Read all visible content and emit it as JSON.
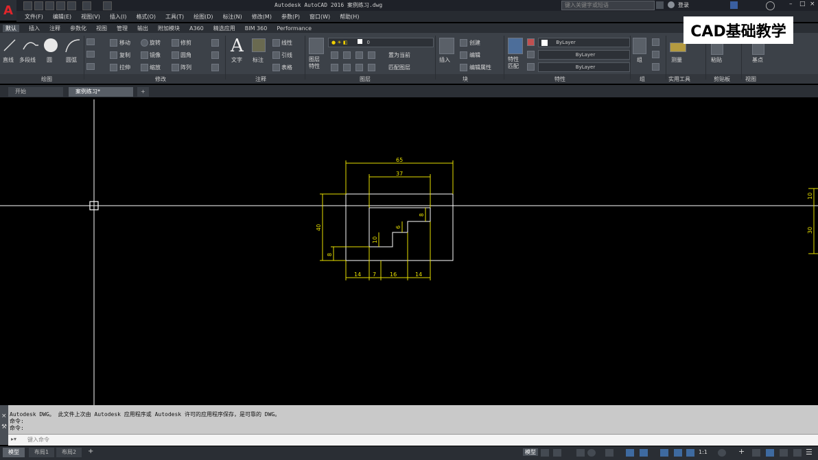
{
  "app": {
    "title": "Autodesk AutoCAD 2016    案例练习.dwg",
    "search_placeholder": "键入关键字或短语",
    "login_label": "登录",
    "logo": "A"
  },
  "menu": [
    "文件(F)",
    "编辑(E)",
    "视图(V)",
    "插入(I)",
    "格式(O)",
    "工具(T)",
    "绘图(D)",
    "标注(N)",
    "修改(M)",
    "参数(P)",
    "窗口(W)",
    "帮助(H)"
  ],
  "ribbon_tabs": [
    "默认",
    "插入",
    "注释",
    "参数化",
    "视图",
    "管理",
    "输出",
    "附加模块",
    "A360",
    "精选应用",
    "BIM 360",
    "Performance"
  ],
  "ribbon": {
    "draw": {
      "title": "绘图",
      "line": "直线",
      "polyline": "多段线",
      "circle": "圆",
      "arc": "圆弧"
    },
    "modify": {
      "title": "修改",
      "items": [
        "移动",
        "旋转",
        "修剪",
        "复制",
        "镜像",
        "圆角",
        "拉伸",
        "缩放",
        "阵列"
      ]
    },
    "annotation": {
      "title": "注释",
      "text": "文字",
      "dimension": "标注",
      "linear": "线性",
      "leader": "引线",
      "table": "表格"
    },
    "layers": {
      "title": "图层",
      "layer_properties": "图层特性",
      "current_layer": "0",
      "set_current": "置为当前",
      "match_layer": "匹配图层"
    },
    "block": {
      "title": "块",
      "insert": "插入",
      "create": "创建",
      "edit": "编辑",
      "edit_attributes": "编辑属性"
    },
    "properties": {
      "title": "特性",
      "match": "特性匹配",
      "color": "ByLayer",
      "linetype": "ByLayer",
      "lineweight": "ByLayer"
    },
    "groups": {
      "title": "组",
      "group": "组"
    },
    "utilities": {
      "title": "实用工具",
      "measure": "测量"
    },
    "clipboard": {
      "title": "剪贴板",
      "paste": "粘贴"
    },
    "view": {
      "title": "视图",
      "base": "基点"
    }
  },
  "file_tabs": {
    "start": "开始",
    "active": "案例练习*",
    "new": "+"
  },
  "watermark": "CAD基础教学",
  "drawing": {
    "dims": {
      "overall_width": "65",
      "inner_width": "37",
      "height_left": "40",
      "small_left": "8",
      "step_right": "8",
      "step_mid": "6",
      "step_inner": "10",
      "bottom": [
        "14",
        "7",
        "16",
        "14"
      ],
      "right_top": "10",
      "right_bottom": "30"
    },
    "colors": {
      "geometry": "#ffffff",
      "dimensions": "#e8e000",
      "crosshair": "#ffffff"
    }
  },
  "command": {
    "history": [
      "Autodesk DWG。   此文件上次由 Autodesk 应用程序或 Autodesk 许可的应用程序保存，是可靠的 DWG。",
      "命令:",
      "命令:"
    ],
    "placeholder": "键入命令"
  },
  "layout_tabs": [
    "模型",
    "布局1",
    "布局2"
  ],
  "status": {
    "model_label": "模型",
    "scale": "1:1"
  }
}
